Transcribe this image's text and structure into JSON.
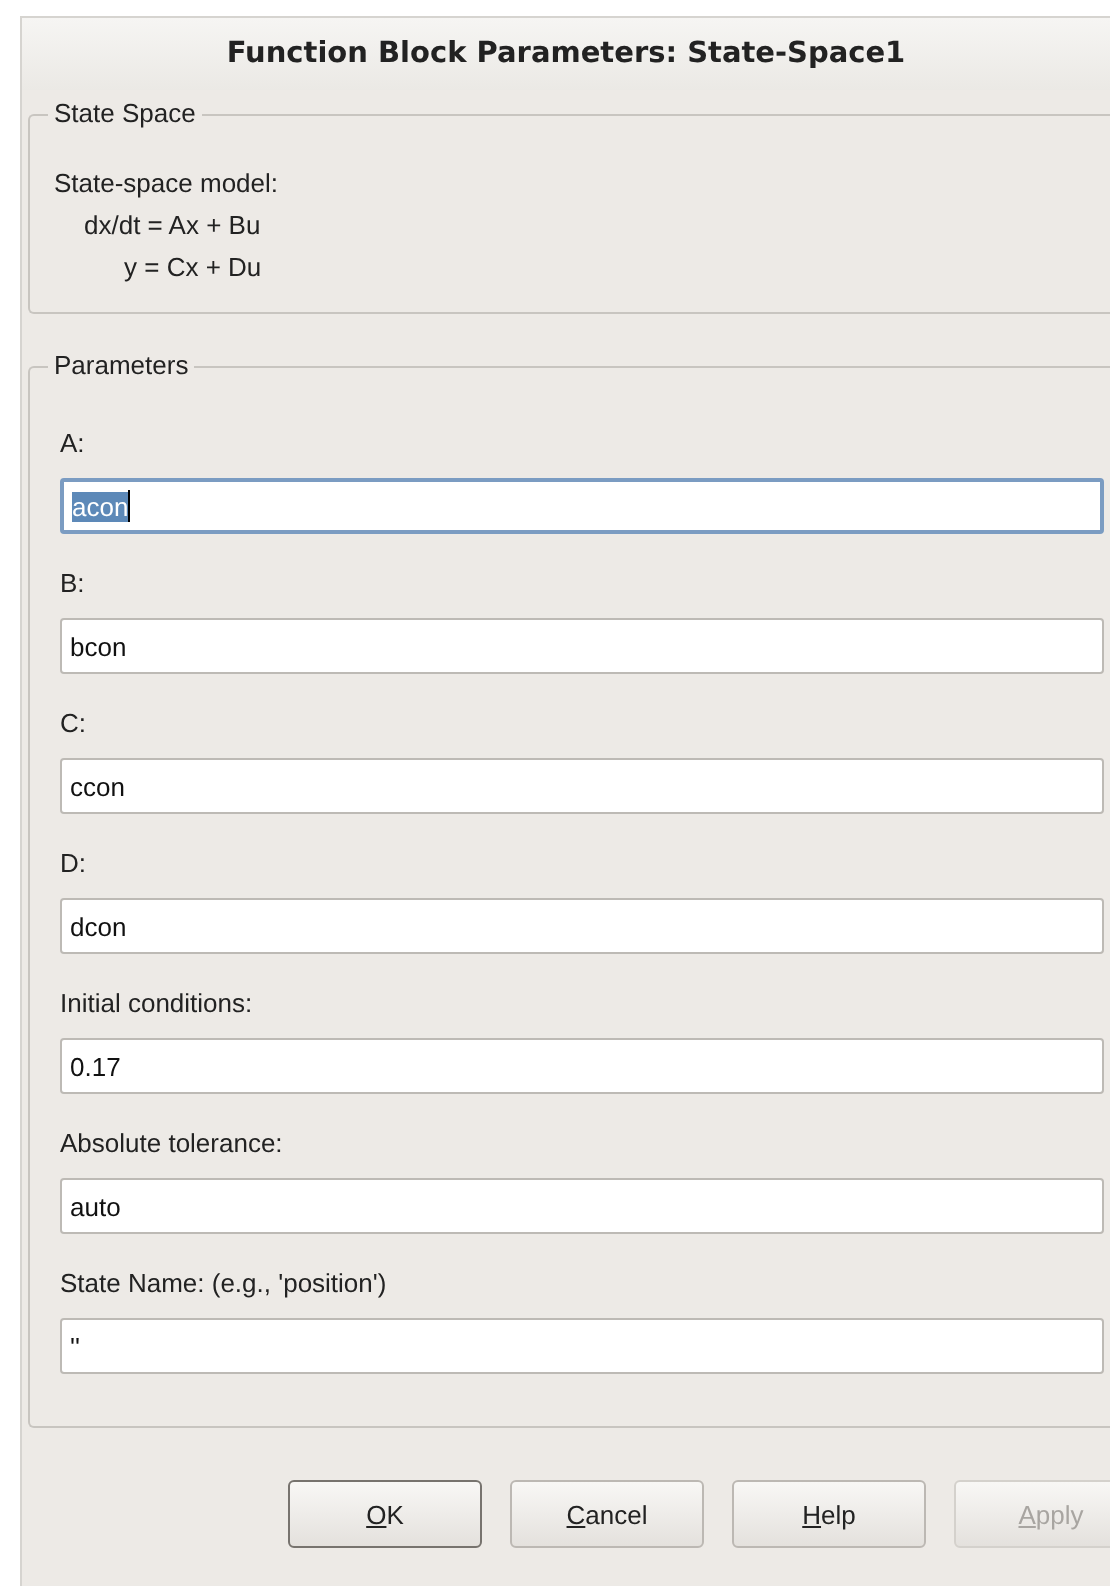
{
  "window": {
    "title": "Function Block Parameters: State-Space1"
  },
  "description_group": {
    "title": "State Space",
    "lines": [
      "State-space model:",
      "dx/dt = Ax + Bu",
      "y = Cx + Du"
    ]
  },
  "parameters_group": {
    "title": "Parameters",
    "fields": [
      {
        "label": "A:",
        "value": "acon",
        "focused": true
      },
      {
        "label": "B:",
        "value": "bcon",
        "focused": false
      },
      {
        "label": "C:",
        "value": "ccon",
        "focused": false
      },
      {
        "label": "D:",
        "value": "dcon",
        "focused": false
      },
      {
        "label": "Initial conditions:",
        "value": "0.17",
        "focused": false
      },
      {
        "label": "Absolute tolerance:",
        "value": "auto",
        "focused": false
      },
      {
        "label": "State Name: (e.g., 'position')",
        "value": "''",
        "focused": false
      }
    ]
  },
  "buttons": [
    {
      "mnemonic": "O",
      "rest": "K",
      "default": true,
      "disabled": false
    },
    {
      "mnemonic": "C",
      "rest": "ancel",
      "default": false,
      "disabled": false
    },
    {
      "mnemonic": "H",
      "rest": "elp",
      "default": false,
      "disabled": false
    },
    {
      "mnemonic": "A",
      "rest": "pply",
      "default": false,
      "disabled": true
    }
  ]
}
